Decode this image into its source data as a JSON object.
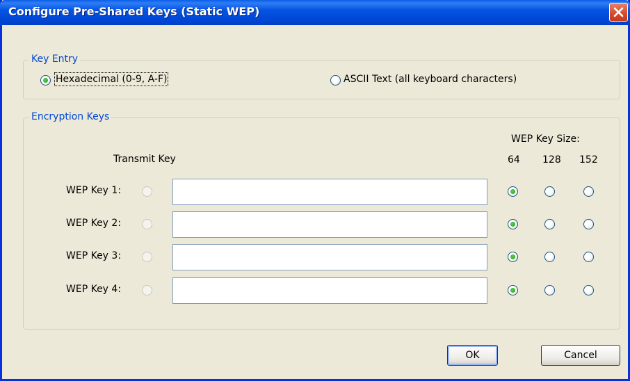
{
  "window": {
    "title": "Configure Pre-Shared Keys (Static WEP)"
  },
  "key_entry": {
    "group_title": "Key Entry",
    "options": [
      {
        "label": "Hexadecimal (0-9, A-F)",
        "selected": true
      },
      {
        "label": "ASCII Text (all keyboard characters)",
        "selected": false
      }
    ]
  },
  "encryption_keys": {
    "group_title": "Encryption Keys",
    "transmit_key_header": "Transmit Key",
    "key_size_header": "WEP Key Size:",
    "sizes": [
      "64",
      "128",
      "152"
    ],
    "keys": [
      {
        "label": "WEP Key 1:",
        "value": "",
        "size": "64"
      },
      {
        "label": "WEP Key 2:",
        "value": "",
        "size": "64"
      },
      {
        "label": "WEP Key 3:",
        "value": "",
        "size": "64"
      },
      {
        "label": "WEP Key 4:",
        "value": "",
        "size": "64"
      }
    ]
  },
  "buttons": {
    "ok": "OK",
    "cancel": "Cancel"
  },
  "colors": {
    "titlebar": "#0054e3",
    "group_title": "#0046d5",
    "background": "#ece9d8",
    "close": "#d64a2b"
  },
  "icons": {
    "close": "close-icon"
  }
}
